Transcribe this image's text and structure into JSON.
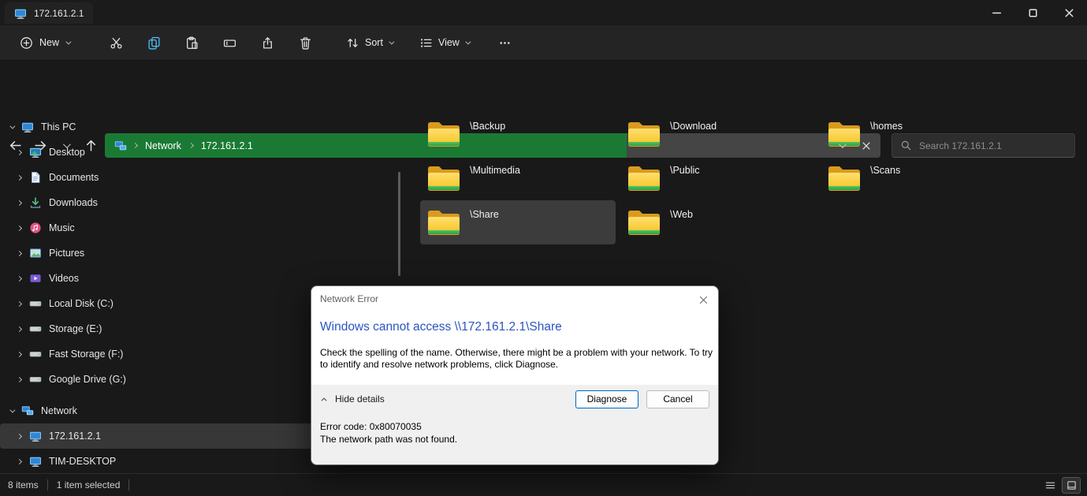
{
  "window": {
    "tab_title": "172.161.2.1"
  },
  "toolbar": {
    "new": "New",
    "sort": "Sort",
    "view": "View",
    "icon_actions": [
      "cut",
      "copy",
      "paste",
      "rename",
      "share",
      "delete",
      "more"
    ]
  },
  "addressbar": {
    "crumbs": [
      "Network",
      "172.161.2.1"
    ]
  },
  "search": {
    "placeholder": "Search 172.161.2.1"
  },
  "sidebar": {
    "items": [
      {
        "label": "This PC"
      },
      {
        "label": "Desktop"
      },
      {
        "label": "Documents"
      },
      {
        "label": "Downloads"
      },
      {
        "label": "Music"
      },
      {
        "label": "Pictures"
      },
      {
        "label": "Videos"
      },
      {
        "label": "Local Disk (C:)"
      },
      {
        "label": "Storage (E:)"
      },
      {
        "label": "Fast Storage (F:)"
      },
      {
        "label": "Google Drive (G:)"
      },
      {
        "label": "Network"
      },
      {
        "label": "172.161.2.1",
        "selected": true
      },
      {
        "label": "TIM-DESKTOP"
      }
    ]
  },
  "files": {
    "folders": [
      "\\Backup",
      "\\Download",
      "\\homes",
      "\\Multimedia",
      "\\Public",
      "\\Scans",
      "\\Share",
      "\\Web"
    ],
    "selected": "\\Share"
  },
  "dialog": {
    "title": "Network Error",
    "heading": "Windows cannot access \\\\172.161.2.1\\Share",
    "body": "Check the spelling of the name. Otherwise, there might be a problem with your network. To try to identify and resolve network problems, click Diagnose.",
    "details_toggle": "Hide details",
    "diagnose": "Diagnose",
    "cancel": "Cancel",
    "error_code": "Error code: 0x80070035",
    "error_message": "The network path was not found."
  },
  "statusbar": {
    "items": "8 items",
    "selected": "1 item selected"
  },
  "colors": {
    "progress_green": "#1a7a33",
    "dialog_heading_blue": "#2b55c0",
    "accent_button_border": "#0067c0",
    "folder_yellow": "#f6c21e"
  }
}
